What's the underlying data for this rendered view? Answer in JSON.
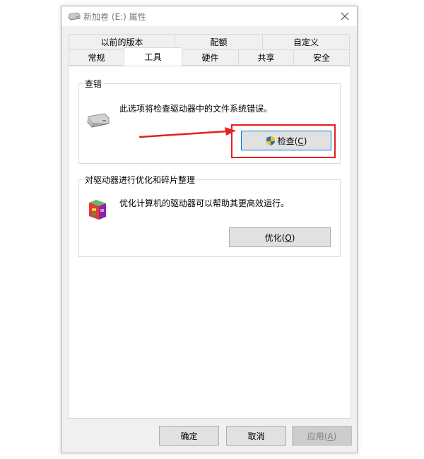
{
  "window": {
    "title": "新加卷 (E:) 属性",
    "close_glyph": "✕"
  },
  "tabs": {
    "row1": [
      {
        "label": "以前的版本"
      },
      {
        "label": "配额"
      },
      {
        "label": "自定义"
      }
    ],
    "row2": [
      {
        "label": "常规"
      },
      {
        "label": "工具",
        "active": true
      },
      {
        "label": "硬件"
      },
      {
        "label": "共享"
      },
      {
        "label": "安全"
      }
    ]
  },
  "error_check": {
    "title": "查错",
    "description": "此选项将检查驱动器中的文件系统错误。",
    "button_text": "检查(",
    "button_key": "C",
    "button_close": ")"
  },
  "optimize": {
    "title": "对驱动器进行优化和碎片整理",
    "description": "优化计算机的驱动器可以帮助其更高效运行。",
    "button_text": "优化(",
    "button_key": "O",
    "button_close": ")"
  },
  "footer": {
    "ok": "确定",
    "cancel": "取消",
    "apply_text": "应用(",
    "apply_key": "A",
    "apply_close": ")"
  },
  "colors": {
    "highlight": "#e42020",
    "accent_focus": "#0078d7"
  }
}
